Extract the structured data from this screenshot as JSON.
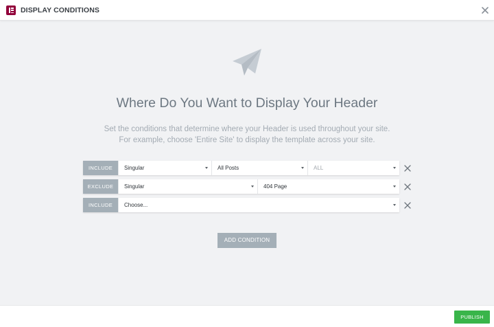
{
  "header": {
    "title": "DISPLAY CONDITIONS",
    "logo_icon": "elementor-logo-icon",
    "close_icon": "close-icon"
  },
  "main": {
    "hero_icon": "paper-plane-icon",
    "heading": "Where Do You Want to Display Your Header",
    "subtitle_line1": "Set the conditions that determine where your Header is used throughout your site.",
    "subtitle_line2": "For example, choose 'Entire Site' to display the template across your site."
  },
  "conditions": [
    {
      "type": "INCLUDE",
      "selects": [
        "Singular",
        "All Posts",
        "ALL"
      ]
    },
    {
      "type": "EXCLUDE",
      "selects": [
        "Singular",
        "404 Page"
      ]
    },
    {
      "type": "INCLUDE",
      "selects": [
        "Choose..."
      ]
    }
  ],
  "add_condition_label": "ADD CONDITION",
  "footer": {
    "publish_label": "PUBLISH"
  },
  "colors": {
    "brand": "#92003b",
    "publish": "#39b54a",
    "type_button": "#a4afb7",
    "background": "#f1f2f4"
  }
}
